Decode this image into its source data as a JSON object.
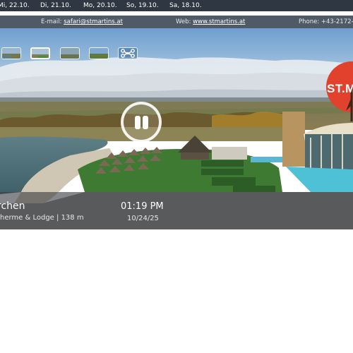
{
  "date_tabs": [
    "Mi, 22.10.",
    "Di, 21.10.",
    "Mo, 20.10.",
    "So, 19.10.",
    "Sa, 18.10."
  ],
  "contact": {
    "email_label": "E-mail:",
    "email": "safari@stmartins.at",
    "web_label": "Web:",
    "web": "www.stmartins.at",
    "phone": "Phone: +43-2172-"
  },
  "thumbnails": [
    {
      "icon": "landscape-thumbnail",
      "active": false
    },
    {
      "icon": "landscape-thumbnail",
      "active": true
    },
    {
      "icon": "landscape-thumbnail",
      "active": false
    },
    {
      "icon": "landscape-thumbnail",
      "active": false
    },
    {
      "icon": "drone-icon",
      "active": false
    }
  ],
  "player": {
    "state_icon": "pause-icon"
  },
  "logo": {
    "text": "ST.M",
    "color": "#e2412e"
  },
  "location": {
    "name": "rchen",
    "subtitle": "herme & Lodge | 138 m"
  },
  "capture": {
    "time": "01:19 PM",
    "date": "10/24/25"
  }
}
